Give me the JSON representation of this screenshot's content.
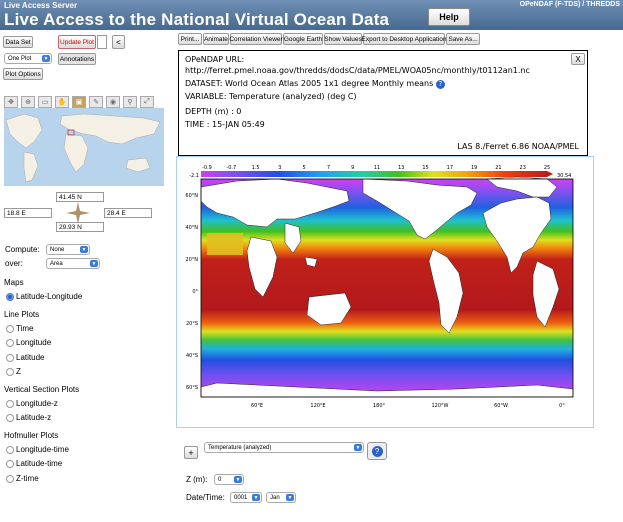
{
  "header": {
    "server_label": "Live Access Server",
    "title": "Live Access to the National Virtual Ocean Data",
    "links": "OPeNDAF (F-TDS) / THREDDS",
    "help_label": "Help"
  },
  "left": {
    "dataset_label": "Data Set",
    "update_plot_label": "Update Plot",
    "back_label": "<",
    "plot_count_value": "One Plot",
    "annotations_label": "Annotations",
    "plot_options_label": "Plot Options",
    "tools": [
      "pan-icon",
      "zoom-icon",
      "rect-icon",
      "hand-icon",
      "select-icon",
      "edit-icon",
      "globe-icon",
      "search-icon",
      "zoom-extent-icon"
    ],
    "coords": {
      "north": "41.45 N",
      "west": "18.8 E",
      "east": "28.4 E",
      "south": "29.93 N"
    },
    "compute_label": "Compute:",
    "compute_value": "None",
    "over_label": "over:",
    "over_value": "Area",
    "sections": [
      {
        "title": "Maps",
        "items": [
          {
            "label": "Latitude-Longitude",
            "selected": true
          }
        ]
      },
      {
        "title": "Line Plots",
        "items": [
          {
            "label": "Time"
          },
          {
            "label": "Longitude"
          },
          {
            "label": "Latitude"
          },
          {
            "label": "Z"
          }
        ]
      },
      {
        "title": "Vertical Section Plots",
        "items": [
          {
            "label": "Longitude-z"
          },
          {
            "label": "Latitude-z"
          }
        ]
      },
      {
        "title": "Hofmuller Plots",
        "items": [
          {
            "label": "Longitude-time"
          },
          {
            "label": "Latitude-time"
          },
          {
            "label": "Z-time"
          }
        ]
      }
    ]
  },
  "toolbar": [
    "Print...",
    "Animate",
    "Correlation Viewer",
    "Google Earth",
    "Show Values",
    "Export to Desktop Application",
    "Save As..."
  ],
  "info": {
    "close_label": "X",
    "url_label": "OPeNDAP URL:",
    "url": "http://ferret.pmel.noaa.gov/thredds/dodsC/data/PMEL/WOA05nc/monthly/t0112an1.nc",
    "dataset": "DATASET: World Ocean Atlas 2005 1x1 degree Monthly means",
    "variable": "VARIABLE: Temperature (analyzed) (deg C)",
    "depth": "DEPTH (m) : 0",
    "time": "TIME : 15-JAN 05:49",
    "footer": "LAS 8./Ferret 6.86 NOAA/PMEL"
  },
  "plot": {
    "colorbar_top_labels": [
      "-0.9",
      "-0.7",
      "1.5",
      "3",
      "5",
      "7",
      "9",
      "11",
      "13",
      "15",
      "17",
      "19",
      "21",
      "23",
      "25"
    ],
    "colorbar_bottom_labels": [
      "-2.1",
      "30.54"
    ],
    "lat_labels": [
      "60°N",
      "40°N",
      "20°N",
      "0°",
      "20°S",
      "40°S",
      "60°S"
    ],
    "lon_labels": [
      "60°E",
      "120°E",
      "180°",
      "120°W",
      "60°W",
      "0°"
    ],
    "colors": {
      "warm": "#b3191c",
      "cold": "#d040f0"
    }
  },
  "bottom": {
    "add_label": "+",
    "variable_value": "Temperature (analyzed)",
    "help_icon": "?",
    "z_label": "Z (m):",
    "z_value": "0",
    "datetime_label": "Date/Time:",
    "year_value": "0001",
    "month_value": "Jan"
  }
}
